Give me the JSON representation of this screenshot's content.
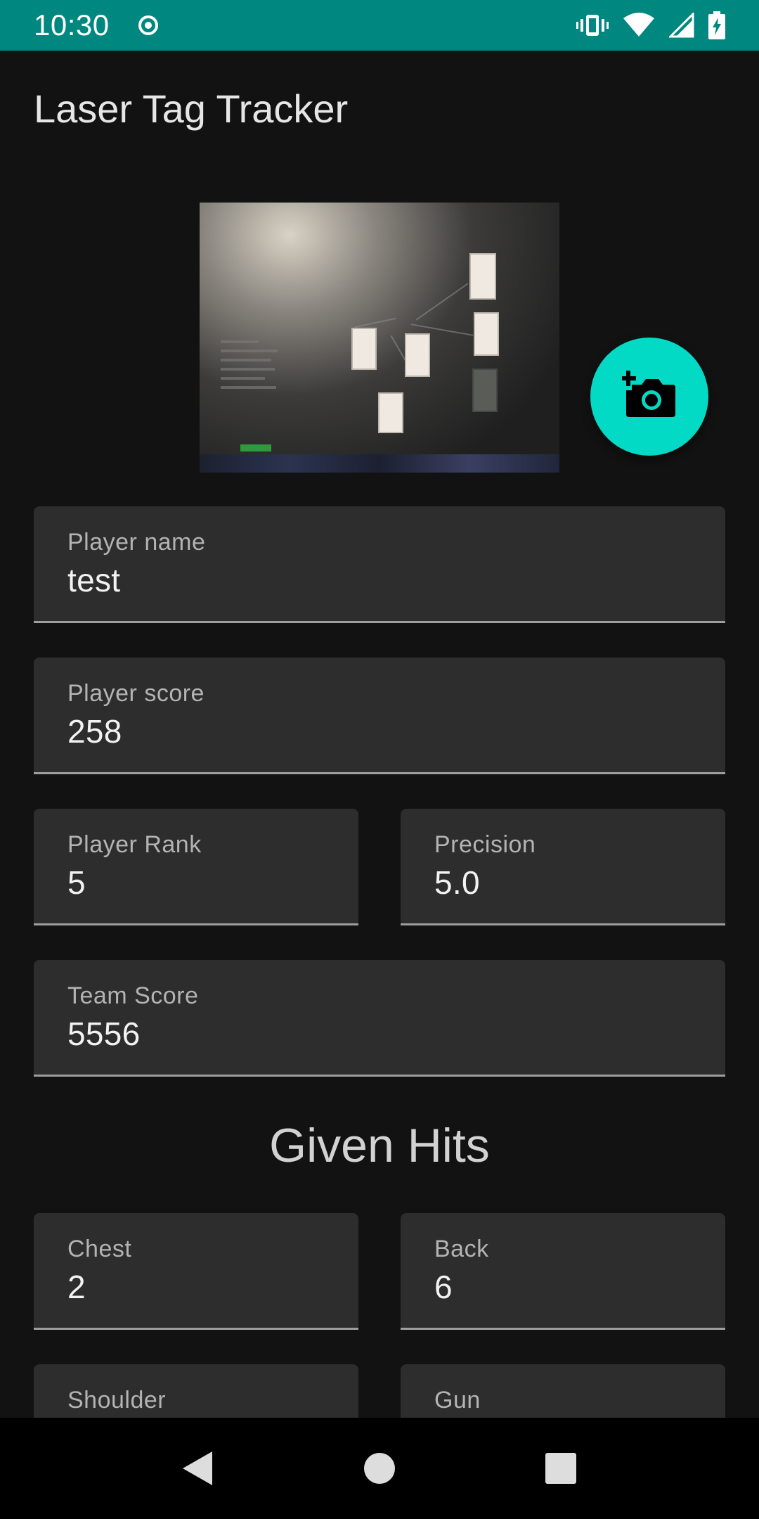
{
  "status_bar": {
    "time": "10:30",
    "icons": [
      "target-icon",
      "vibrate-icon",
      "wifi-icon",
      "signal-icon",
      "battery-charging-icon"
    ]
  },
  "app": {
    "title": "Laser Tag Tracker"
  },
  "photo": {
    "icon": "photo-thumbnail"
  },
  "fab": {
    "icon": "add-photo-camera-icon",
    "color": "#03dac5"
  },
  "fields": {
    "player_name": {
      "label": "Player name",
      "value": "test"
    },
    "player_score": {
      "label": "Player score",
      "value": "258"
    },
    "player_rank": {
      "label": "Player Rank",
      "value": "5"
    },
    "precision": {
      "label": "Precision",
      "value": "5.0"
    },
    "team_score": {
      "label": "Team Score",
      "value": "5556"
    }
  },
  "given_hits": {
    "title": "Given Hits",
    "chest": {
      "label": "Chest",
      "value": "2"
    },
    "back": {
      "label": "Back",
      "value": "6"
    },
    "shoulder": {
      "label": "Shoulder",
      "value": ""
    },
    "gun": {
      "label": "Gun",
      "value": ""
    }
  },
  "nav": {
    "icons": [
      "back-icon",
      "home-icon",
      "recents-icon"
    ]
  },
  "colors": {
    "status_bar": "#00877f",
    "background": "#121212",
    "field_background": "#2d2d2d",
    "accent": "#03dac5"
  }
}
